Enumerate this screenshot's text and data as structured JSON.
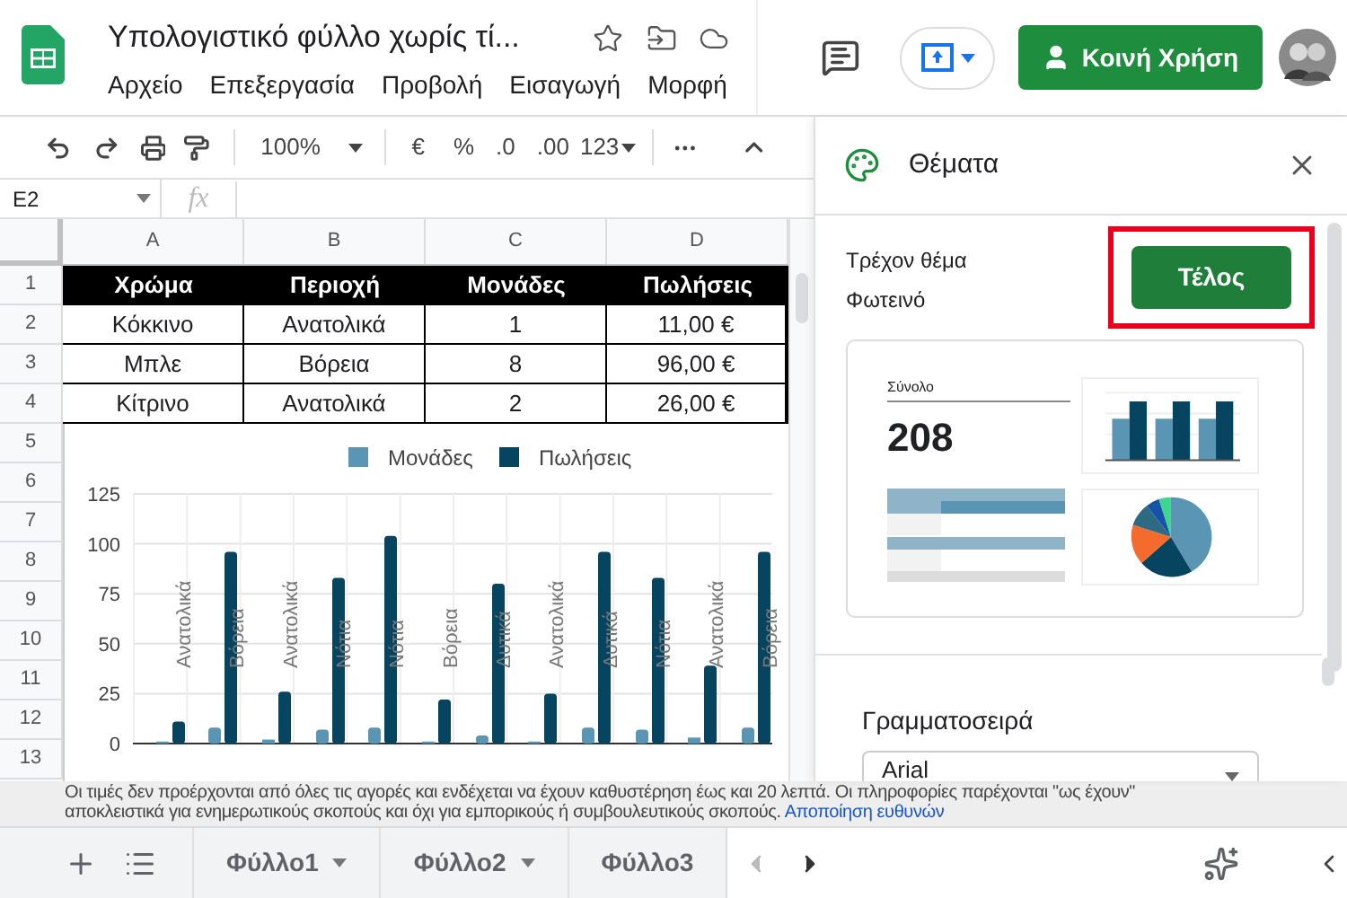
{
  "app": {
    "title": "Υπολογιστικό φύλλο χωρίς τί...",
    "menu": [
      "Αρχείο",
      "Επεξεργασία",
      "Προβολή",
      "Εισαγωγή",
      "Μορφή"
    ],
    "share_button": "Κοινή Χρήση"
  },
  "toolbar": {
    "zoom": "100%",
    "currency": "€",
    "percent": "%",
    "decrease_decimals": ".0",
    "increase_decimals": ".00",
    "more_formats": "123"
  },
  "formula_bar": {
    "cell_ref": "E2",
    "fx": "fx"
  },
  "sheet": {
    "columns": [
      "A",
      "B",
      "C",
      "D"
    ],
    "row_numbers": [
      "1",
      "2",
      "3",
      "4",
      "5",
      "6",
      "7",
      "8",
      "9",
      "10",
      "11",
      "12",
      "13"
    ],
    "header": [
      "Χρώμα",
      "Περιοχή",
      "Μονάδες",
      "Πωλήσεις"
    ],
    "rows": [
      [
        "Κόκκινο",
        "Ανατολικά",
        "1",
        "11,00 €"
      ],
      [
        "Μπλε",
        "Βόρεια",
        "8",
        "96,00 €"
      ],
      [
        "Κίτρινο",
        "Ανατολικά",
        "2",
        "26,00 €"
      ]
    ],
    "chart": {
      "chart_data": {
        "type": "bar",
        "categories": [
          "Ανατολικά",
          "Βόρεια",
          "Ανατολικά",
          "Νότια",
          "Νότια",
          "Βόρεια",
          "Δυτικά",
          "Ανατολικά",
          "Δυτικά",
          "Νότια",
          "Ανατολικά",
          "Βόρεια"
        ],
        "series": [
          {
            "name": "Μονάδες",
            "color": "#5b95b4",
            "values": [
              1,
              8,
              2,
              7,
              8,
              1,
              4,
              1,
              8,
              7,
              3,
              8
            ]
          },
          {
            "name": "Πωλήσεις",
            "color": "#06445f",
            "values": [
              11,
              96,
              26,
              83,
              104,
              22,
              80,
              25,
              96,
              83,
              39,
              96
            ]
          }
        ],
        "ylim": [
          0,
          125
        ],
        "yticks": [
          0,
          25,
          50,
          75,
          100,
          125
        ],
        "grid": true,
        "legend": true
      }
    }
  },
  "themes_panel": {
    "title": "Θέματα",
    "current_label": "Τρέχον θέμα",
    "current_theme": "Φωτεινό",
    "done_button": "Τέλος",
    "preview": {
      "total_label": "Σύνολο",
      "total_value": "208"
    },
    "font_label": "Γραμματοσειρά",
    "font_value": "Arial"
  },
  "notice": {
    "line_1": "Οι τιμές δεν προέρχονται από όλες τις αγορές και ενδέχεται να έχουν καθυστέρηση έως και 20 λεπτά. Οι πληροφορίες παρέχονται \"ως έχουν\"",
    "line_2": "αποκλειστικά για ενημερωτικούς σκοπούς και όχι για εμπορικούς ή συμβουλευτικούς σκοπούς.",
    "link": "Αποποίηση ευθυνών"
  },
  "sheet_tabs": [
    {
      "label": "Φύλλο1",
      "has_menu": true
    },
    {
      "label": "Φύλλο2",
      "has_menu": true
    },
    {
      "label": "Φύλλο3",
      "has_menu": false
    }
  ]
}
